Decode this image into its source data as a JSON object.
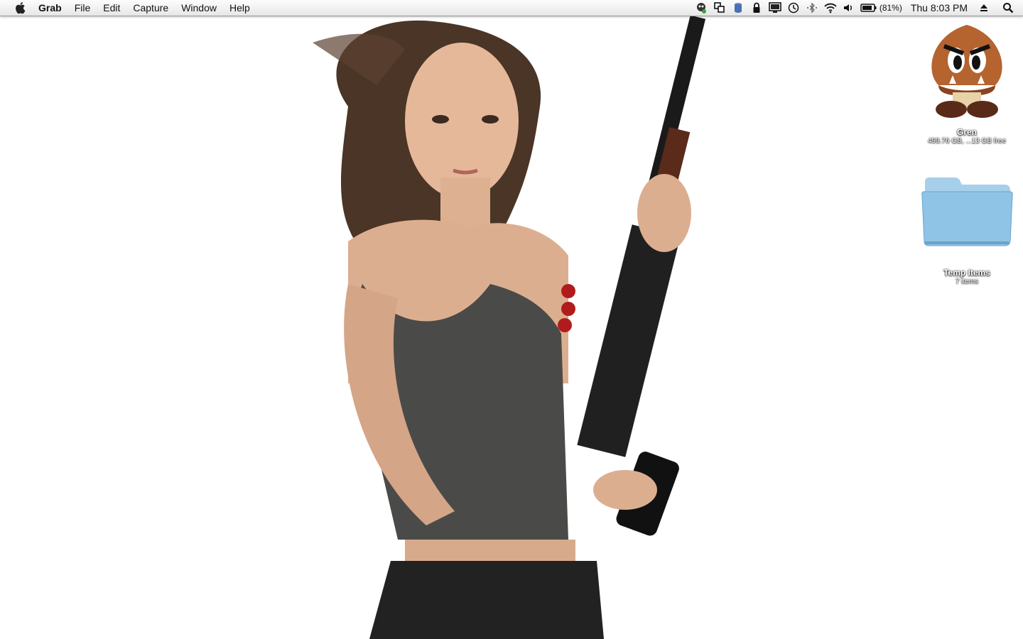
{
  "menubar": {
    "app_name": "Grab",
    "items": [
      "File",
      "Edit",
      "Capture",
      "Window",
      "Help"
    ],
    "status_icons": [
      "growl-icon",
      "spaces-icon",
      "database-icon",
      "lock-icon",
      "display-icon",
      "time-machine-icon",
      "bluetooth-icon",
      "wifi-icon",
      "volume-icon"
    ],
    "battery_percent": "(81%)",
    "clock": "Thu 8:03 PM"
  },
  "desktop": {
    "drive": {
      "name": "Gren",
      "info": "499.76 GB, ...13 GB free",
      "icon": "goomba-drive-icon"
    },
    "folder": {
      "name": "Temp Items",
      "info": "7 items",
      "icon": "folder-icon"
    }
  },
  "colors": {
    "folder_blue": "#8fc4e6",
    "goomba_brown": "#b5632f",
    "menubar_top": "#fdfdfd"
  }
}
